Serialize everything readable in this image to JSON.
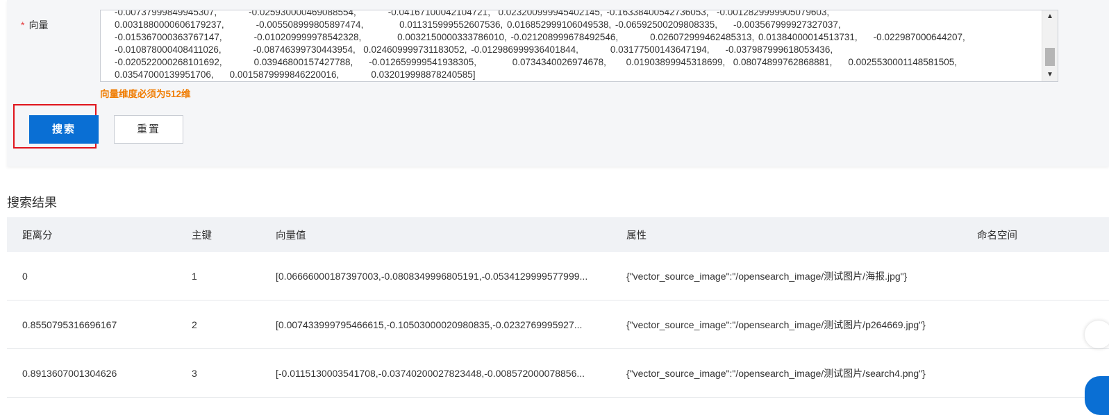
{
  "form": {
    "required_mark": "*",
    "vector_label": "向量",
    "vector_value": "-0.00737999849945307,        -0.025930000469088554,        -0.04167100042104721,  0.023200999945402145, -0.16338400542736053,  -0.0012829999905079603,\n0.0031880000606179237,        -0.005508999805897474,         0.011315999552607536, 0.016852999106049538, -0.06592500209808335,    -0.003567999927327037,\n-0.015367000363767147,        -0.010209999978542328,         0.0032150000333786010, -0.021208999678492546,        0.026072999462485313, 0.01384000014513731,    -0.022987000644207,\n-0.010878000408411026,        -0.08746399730443954,  0.024609999731183052, -0.012986999936401844,        0.03177500143647194,    -0.037987999618053436,\n-0.020522000268101692,        0.03946800157427788,    -0.012659999541938305,         0.0734340026974678,     0.01903899945318699,  0.08074899762868881,    0.002553000114858150​5,\n0.03547000139951706,    0.0015879999846220016,        0.032019998878240585]",
    "error_message": "向量维度必须为512维",
    "search_button": "搜索",
    "reset_button": "重置"
  },
  "icons": {
    "scroll_up": "scroll-up-arrow-icon",
    "scroll_down": "scroll-down-arrow-icon"
  },
  "results": {
    "title": "搜索结果",
    "columns": [
      "距离分",
      "主键",
      "向量值",
      "属性",
      "命名空间"
    ],
    "rows": [
      {
        "score": "0",
        "key": "1",
        "vector": "[0.06666000187397003,-0.0808349996805191,-0.0534129999577999...",
        "attributes": "{\"vector_source_image\":\"/opensearch_image/测试图片/海报.jpg\"}",
        "namespace": ""
      },
      {
        "score": "0.8550795316696167",
        "key": "2",
        "vector": "[0.007433999795466615,-0.10503000020980835,-0.0232769995927...",
        "attributes": "{\"vector_source_image\":\"/opensearch_image/测试图片/p264669.jpg\"}",
        "namespace": ""
      },
      {
        "score": "0.8913607001304626",
        "key": "3",
        "vector": "[-0.0115130003541708,-0.03740200027823448,-0.008572000078856...",
        "attributes": "{\"vector_source_image\":\"/opensearch_image/测试图片/search4.png\"}",
        "namespace": ""
      }
    ]
  },
  "colors": {
    "primary": "#0a6fd4",
    "error": "#f07c00",
    "required": "#e4393c",
    "highlight": "#e0141c"
  }
}
